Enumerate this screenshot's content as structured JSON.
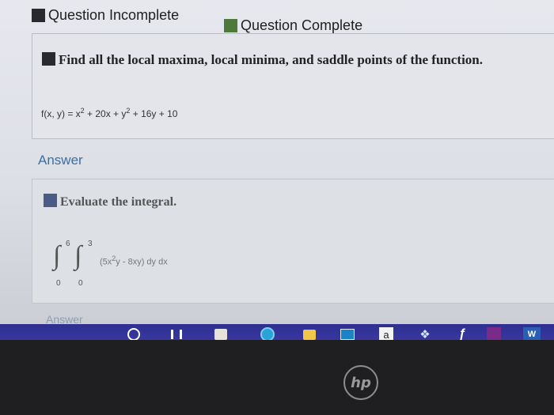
{
  "legend": {
    "incomplete_label": "Question Incomplete",
    "complete_label": "Question Complete"
  },
  "question1": {
    "prompt": "Find all the local maxima, local minima, and saddle points of the function.",
    "formula_prefix": "f(x, y) = x",
    "exp1": "2",
    "formula_mid": " + 20x + y",
    "exp2": "2",
    "formula_suffix": " + 16y + 10"
  },
  "answer1_label": "Answer",
  "question2": {
    "prompt": "Evaluate the integral.",
    "outer_upper": "6",
    "outer_lower": "0",
    "inner_upper": "3",
    "inner_lower": "0",
    "integrand_a": "(5x",
    "integrand_exp": "2",
    "integrand_b": "y - 8xy) dy dx"
  },
  "answer2_label": "Answer",
  "taskbar": {
    "amazon_letter": "a",
    "word_letter": "W",
    "dropbox_glyph": "❖",
    "flash_glyph": "ƒ"
  },
  "brand": {
    "logo_text": "hp"
  }
}
